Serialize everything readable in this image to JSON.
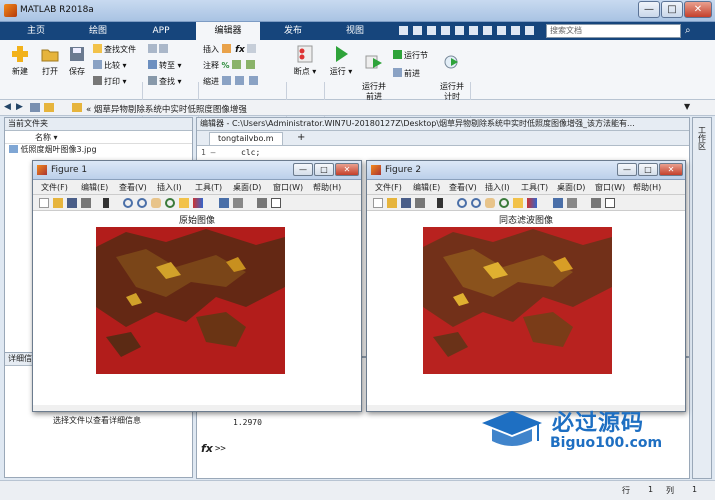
{
  "window": {
    "title": "MATLAB R2018a",
    "min_label": "—",
    "max_label": "□",
    "close_label": "✕"
  },
  "tabs": [
    "主页",
    "绘图",
    "APP",
    "编辑器",
    "发布",
    "视图"
  ],
  "search": {
    "placeholder": "搜索文档"
  },
  "ribbon": {
    "file_group": "文件",
    "nav_group": "导航",
    "edit_group": "编辑",
    "breakpoint_group": "断点",
    "run_group": "运行",
    "new": "新建",
    "open": "打开",
    "save": "保存",
    "find_files": "查找文件",
    "compare": "比较",
    "print": "打印",
    "goto": "转至",
    "find": "查找",
    "insert": "插入",
    "comment": "注释",
    "indent": "缩进",
    "breakpoints": "断点",
    "run": "运行",
    "run_advance": "运行并\n前进",
    "run_section": "运行节",
    "advance": "前进",
    "run_time": "运行并\n计时"
  },
  "address": {
    "path": "« 烟草异物剔除系统中实时低照度图像增强"
  },
  "current_folder": {
    "title": "当前文件夹",
    "col_name": "名称 ▾",
    "file": "低照度烟叶图像3.jpg",
    "detail_title": "详细信息",
    "detail_text": "选择文件以查看详细信息"
  },
  "editor": {
    "title": "编辑器 - C:\\Users\\Administrator.WIN7U-20180127Z\\Desktop\\烟草异物剔除系统中实时低照度图像增强_该方法能有...",
    "tab": "tongtailvbo.m",
    "add_tab": "+",
    "line_no": "1 –",
    "code_line": "clc;"
  },
  "command": {
    "value": "1.2970",
    "fx": "fx",
    "prompt": ">>"
  },
  "workspace_label": "工作区",
  "figures": [
    {
      "title": "Figure 1",
      "image_title": "原始图像"
    },
    {
      "title": "Figure 2",
      "image_title": "同态滤波图像"
    }
  ],
  "fig_menu": [
    "文件(F)",
    "编辑(E)",
    "查看(V)",
    "插入(I)",
    "工具(T)",
    "桌面(D)",
    "窗口(W)",
    "帮助(H)"
  ],
  "watermark": {
    "cn": "必过源码",
    "en": "Biguo100.com"
  },
  "status": {
    "row_label": "行",
    "row": "1",
    "col_label": "列",
    "col": "1"
  },
  "colors": {
    "tabbar": "#16457c",
    "image_red": "#b8201e",
    "watermark_blue": "#1e6fc2"
  }
}
